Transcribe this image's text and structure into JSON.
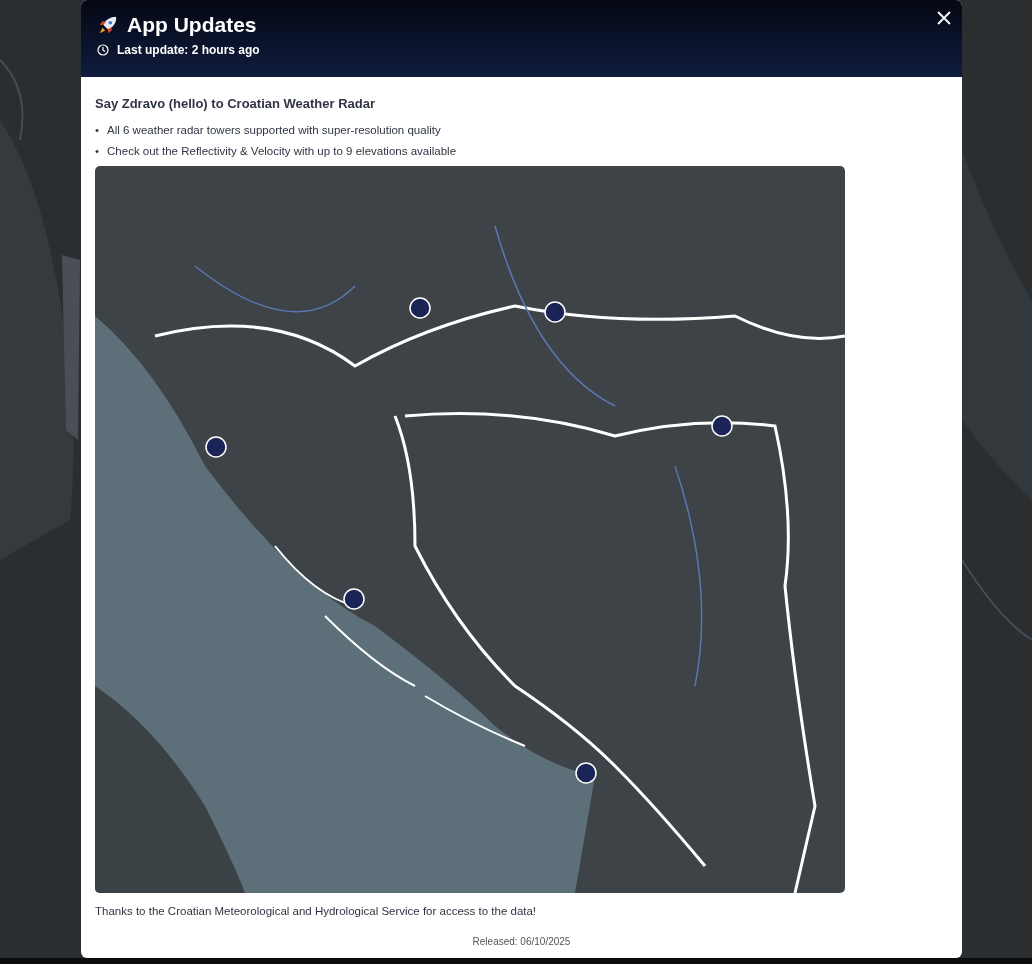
{
  "modal": {
    "title": "App Updates",
    "subtitle": "Last update: 2 hours ago"
  },
  "update": {
    "heading": "Say Zdravo (hello) to Croatian Weather Radar",
    "bullets": [
      {
        "marker": "•",
        "text": "All 6 weather radar towers supported with super-resolution quality"
      },
      {
        "marker": "•",
        "text": "Check out the Reflectivity & Velocity with up to 9 elevations available"
      }
    ],
    "thanks": "Thanks to the Croatian Meteorological and Hydrological Service for access to the data!",
    "released": "Released: 06/10/2025"
  }
}
